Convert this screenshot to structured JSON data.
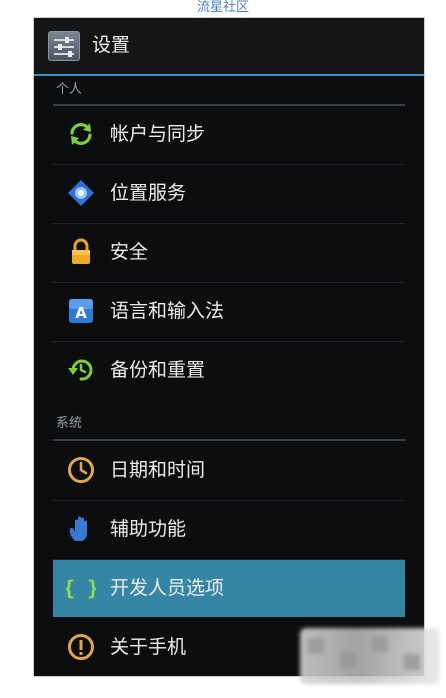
{
  "watermark": "流星社区",
  "header": {
    "title": "设置",
    "icon": "settings-sliders-icon"
  },
  "sections": [
    {
      "title": "个人",
      "items": [
        {
          "label": "帐户与同步",
          "icon": "sync-icon"
        },
        {
          "label": "位置服务",
          "icon": "location-icon"
        },
        {
          "label": "安全",
          "icon": "lock-icon"
        },
        {
          "label": "语言和输入法",
          "icon": "language-icon"
        },
        {
          "label": "备份和重置",
          "icon": "backup-restore-icon"
        }
      ]
    },
    {
      "title": "系统",
      "items": [
        {
          "label": "日期和时间",
          "icon": "clock-icon"
        },
        {
          "label": "辅助功能",
          "icon": "hand-icon"
        },
        {
          "label": "开发人员选项",
          "icon": "braces-icon",
          "selected": true
        },
        {
          "label": "关于手机",
          "icon": "info-icon"
        }
      ]
    }
  ],
  "colors": {
    "accent": "#3a90c3",
    "selected_row": "#3585a5",
    "background": "#0c0d0f",
    "text": "#ededed",
    "section_text": "#9aa0a6"
  }
}
